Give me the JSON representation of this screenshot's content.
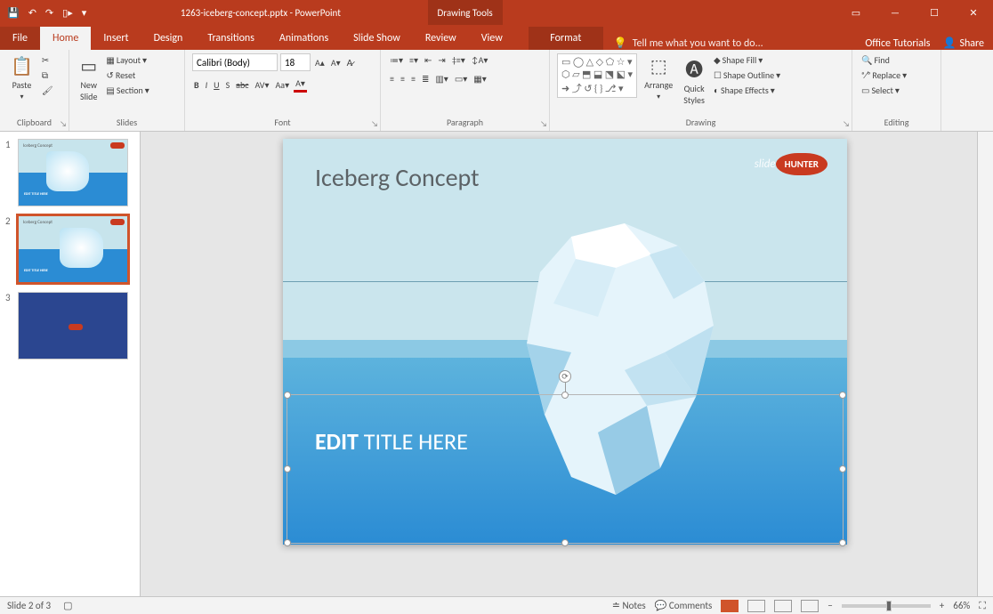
{
  "titlebar": {
    "filename": "1263-iceberg-concept.pptx - PowerPoint",
    "context_tab_group": "Drawing Tools"
  },
  "tabs": {
    "file": "File",
    "items": [
      "Home",
      "Insert",
      "Design",
      "Transitions",
      "Animations",
      "Slide Show",
      "Review",
      "View"
    ],
    "context": "Format",
    "tellme": "Tell me what you want to do...",
    "office_tutorials": "Office Tutorials",
    "share": "Share"
  },
  "ribbon": {
    "clipboard": {
      "paste": "Paste",
      "label": "Clipboard"
    },
    "slides": {
      "new_slide": "New\nSlide",
      "layout": "Layout",
      "reset": "Reset",
      "section": "Section",
      "label": "Slides"
    },
    "font": {
      "font": "Calibri (Body)",
      "size": "18",
      "label": "Font"
    },
    "paragraph": {
      "label": "Paragraph"
    },
    "drawing": {
      "arrange": "Arrange",
      "quick": "Quick\nStyles",
      "fill": "Shape Fill",
      "outline": "Shape Outline",
      "effects": "Shape Effects",
      "label": "Drawing"
    },
    "editing": {
      "find": "Find",
      "replace": "Replace",
      "select": "Select",
      "label": "Editing"
    }
  },
  "thumbnails": [
    {
      "num": "1",
      "title": "Iceberg Concept",
      "edit": "EDIT TITLE HERE"
    },
    {
      "num": "2",
      "title": "Iceberg Concept",
      "edit": "EDIT TITLE HERE"
    },
    {
      "num": "3",
      "title": "",
      "edit": ""
    }
  ],
  "slide": {
    "title": "Iceberg Concept",
    "logo_word1": "slide",
    "logo_word2": "HUNTER",
    "edit_bold": "EDIT",
    "edit_rest": " TITLE HERE"
  },
  "status": {
    "slide_info": "Slide 2 of 3",
    "lang": "",
    "notes": "Notes",
    "comments": "Comments",
    "zoom": "66%"
  }
}
